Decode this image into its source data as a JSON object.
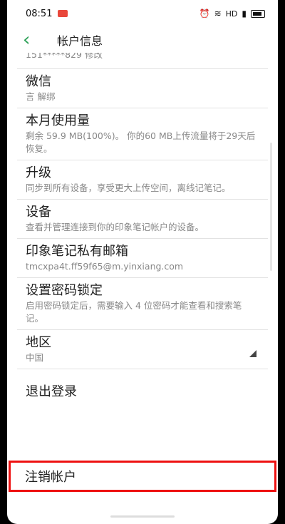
{
  "status_bar": {
    "time": "08:51",
    "network": "HD"
  },
  "header": {
    "title": "帐户信息"
  },
  "top_partial": {
    "text": "151*****829  修改"
  },
  "items": [
    {
      "title": "微信",
      "subtitle": "言 解绑"
    },
    {
      "title": "本月使用量",
      "subtitle": "剩余 59.9 MB(100%)。 你的60 MB上传流量将于29天后恢复。"
    },
    {
      "title": "升级",
      "subtitle": "同步到所有设备，享受更大上传空间，离线记笔记。"
    },
    {
      "title": "设备",
      "subtitle": "查看并管理连接到你的印象笔记帐户的设备。"
    },
    {
      "title": "印象笔记私有邮箱",
      "subtitle": "tmcxpa4t.ff59f65@m.yinxiang.com"
    },
    {
      "title": "设置密码锁定",
      "subtitle": "启用密码锁定后，需要输入 4 位密码才能查看和搜索笔记。"
    },
    {
      "title": "地区",
      "subtitle": "中国"
    }
  ],
  "logout": {
    "label": "退出登录"
  },
  "deregister": {
    "label": "注销帐户"
  },
  "colors": {
    "accent": "#2da157",
    "highlight": "#e11"
  }
}
